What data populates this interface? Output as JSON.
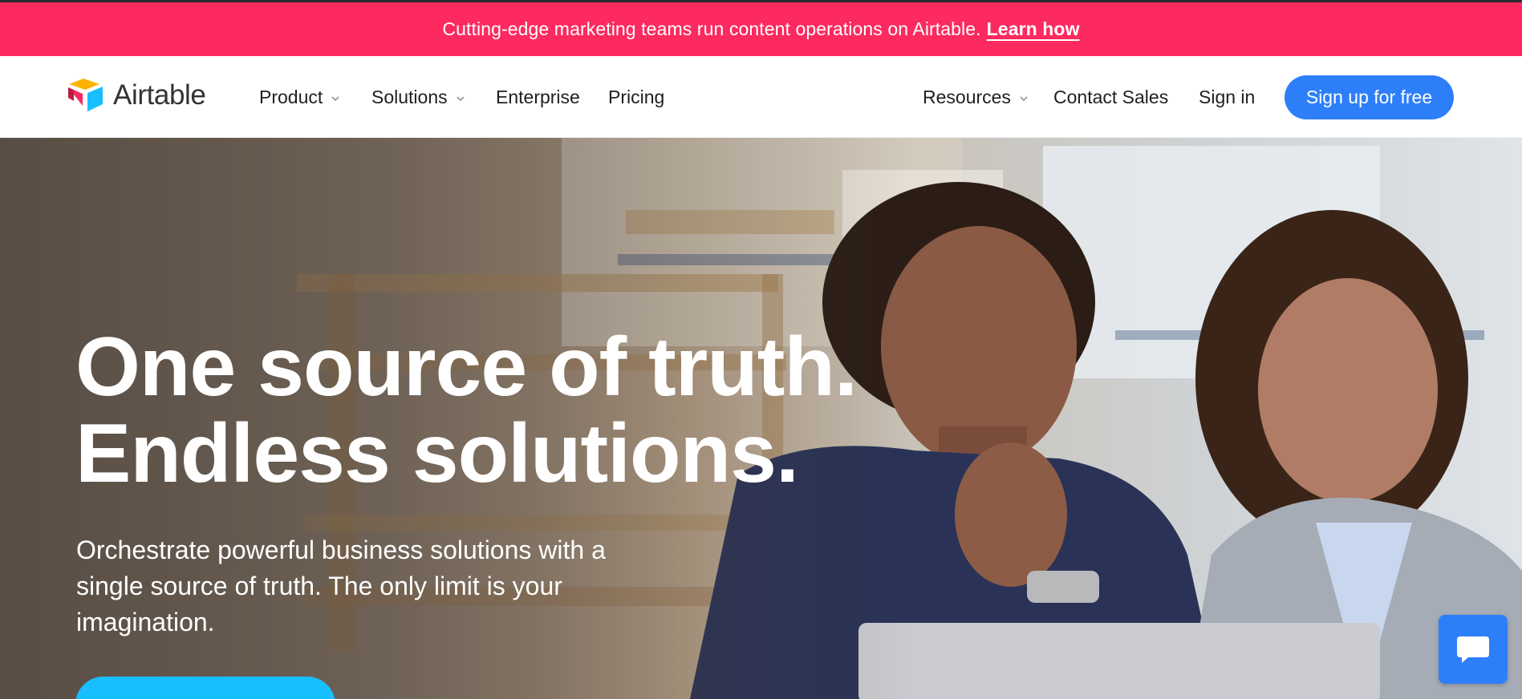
{
  "banner": {
    "message": "Cutting-edge marketing teams run content operations on Airtable.",
    "link": "Learn how"
  },
  "nav": {
    "logo": "Airtable",
    "left_items": [
      {
        "label": "Product",
        "dropdown": true
      },
      {
        "label": "Solutions",
        "dropdown": true
      },
      {
        "label": "Enterprise",
        "dropdown": false
      },
      {
        "label": "Pricing",
        "dropdown": false
      }
    ],
    "right_items": [
      {
        "label": "Resources",
        "dropdown": true
      },
      {
        "label": "Contact Sales",
        "dropdown": false
      },
      {
        "label": "Sign in",
        "dropdown": false
      }
    ],
    "cta": "Sign up for free"
  },
  "hero": {
    "headline_line1": "One source of truth.",
    "headline_line2": "Endless solutions.",
    "subhead": "Orchestrate powerful business solutions with a single source of truth. The only limit is your imagination."
  },
  "icons": {
    "chevron": "chevron-down-icon",
    "chat": "chat-icon",
    "logo": "airtable-logo-icon"
  },
  "colors": {
    "banner": "#fc2a5f",
    "cta": "#2d7ff9",
    "hero_button": "#18bfff",
    "chat_button": "#2d7ff9"
  }
}
